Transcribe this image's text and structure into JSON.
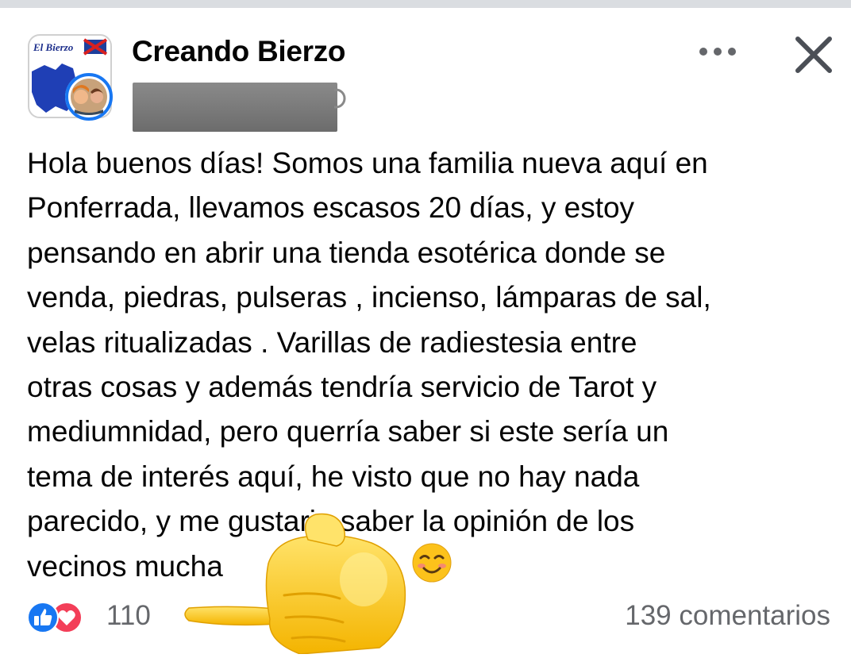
{
  "header": {
    "group_name": "Creando Bierzo",
    "avatar_logo_text": "El Bierzo"
  },
  "post": {
    "text": "Hola buenos días! Somos una familia nueva aquí en\nPonferrada, llevamos escasos 20 días, y estoy\npensando en abrir una tienda esotérica donde se\nvenda, piedras, pulseras , incienso, lámparas de sal,\nvelas ritualizadas . Varillas de radiestesia entre\notras cosas y además tendría servicio de Tarot y\nmediumnidad, pero querría saber si este sería un\ntema de interés aquí, he visto que no hay nada\nparecido, y me gustaria saber la opinión de los\nvecinos mucha"
  },
  "footer": {
    "reaction_count": "110",
    "comment_count": "139 comentarios"
  },
  "icons": {
    "more": "more-dots-icon",
    "close": "close-icon",
    "like": "like-icon",
    "love": "love-icon",
    "emoji": "smiling-face-emoji",
    "hand": "pointing-hand-emoji"
  },
  "colors": {
    "like_blue": "#1877f2",
    "love_red": "#f33e58",
    "secondary_text": "#65676b",
    "avatar_ring": "#1877f2"
  }
}
